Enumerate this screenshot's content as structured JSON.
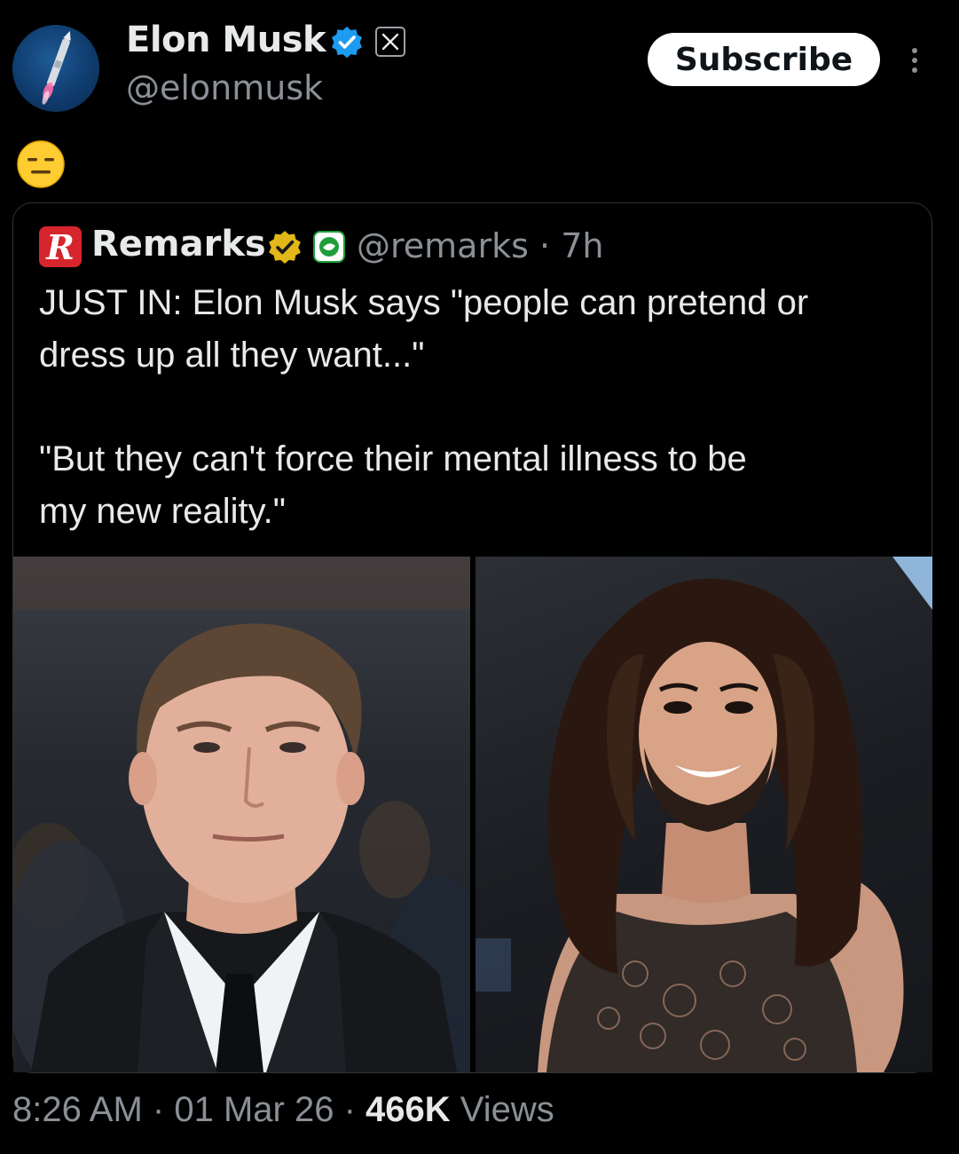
{
  "author": {
    "name": "Elon Musk",
    "handle": "@elonmusk",
    "verified_icon": "blue-check-badge",
    "affiliation_icon": "x-logo"
  },
  "actions": {
    "subscribe_label": "Subscribe",
    "more_icon": "more-vertical-icon"
  },
  "post": {
    "emoji": "😑"
  },
  "quoted": {
    "name": "Remarks",
    "logo_letter": "R",
    "handle": "@remarks",
    "separator": "·",
    "time": "7h",
    "verified_icon": "gold-check-badge",
    "text_lines": [
      "JUST IN: Elon Musk says \"people can pretend or",
      "dress up all they want...\"",
      "\"But they can't force their mental illness to be",
      "my new reality.\""
    ],
    "images": [
      "photo-man-in-suit",
      "photo-person-with-long-hair-and-beard"
    ]
  },
  "meta": {
    "time": "8:26 AM",
    "date": "01 Mar 26",
    "views_count": "466K",
    "views_label": "Views",
    "separator": "·"
  },
  "colors": {
    "background": "#000000",
    "text_primary": "#e7e9ea",
    "text_secondary": "#8b9096",
    "verified_blue": "#1d9bf0",
    "verified_gold": "#e2b719",
    "remarks_red": "#d6252d"
  }
}
